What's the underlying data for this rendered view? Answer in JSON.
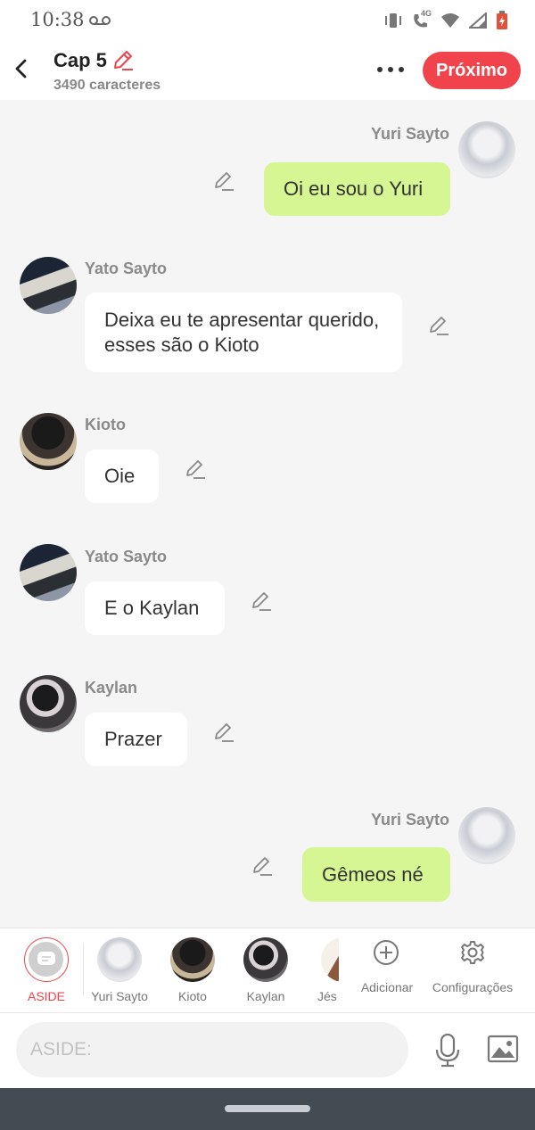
{
  "status_bar": {
    "time": "10:38",
    "network": "4G"
  },
  "header": {
    "title": "Cap 5",
    "subtitle": "3490 caracteres",
    "next_label": "Próximo"
  },
  "messages": [
    {
      "sender": "Yuri Sayto",
      "text": "Oi eu sou o Yuri",
      "side": "right"
    },
    {
      "sender": "Yato Sayto",
      "text": "Deixa eu te apresentar querido, esses são o Kioto",
      "side": "left"
    },
    {
      "sender": "Kioto",
      "text": "Oie",
      "side": "left"
    },
    {
      "sender": "Yato Sayto",
      "text": "E o Kaylan",
      "side": "left"
    },
    {
      "sender": "Kaylan",
      "text": "Prazer",
      "side": "left"
    },
    {
      "sender": "Yuri Sayto",
      "text": "Gêmeos né",
      "side": "right"
    }
  ],
  "character_bar": {
    "aside_label": "ASIDE",
    "characters": [
      "Yuri Sayto",
      "Kioto",
      "Kaylan",
      "Jés"
    ],
    "add_label": "Adicionar",
    "settings_label": "Configurações"
  },
  "input": {
    "placeholder": "ASIDE:"
  },
  "colors": {
    "accent": "#f0434b",
    "my_bubble": "#d6f593",
    "other_bubble": "#ffffff"
  },
  "icons": [
    "back-arrow-icon",
    "pencil-icon",
    "more-icon",
    "mic-icon",
    "image-icon",
    "plus-circle-icon",
    "gear-icon",
    "chat-bubble-icon"
  ]
}
